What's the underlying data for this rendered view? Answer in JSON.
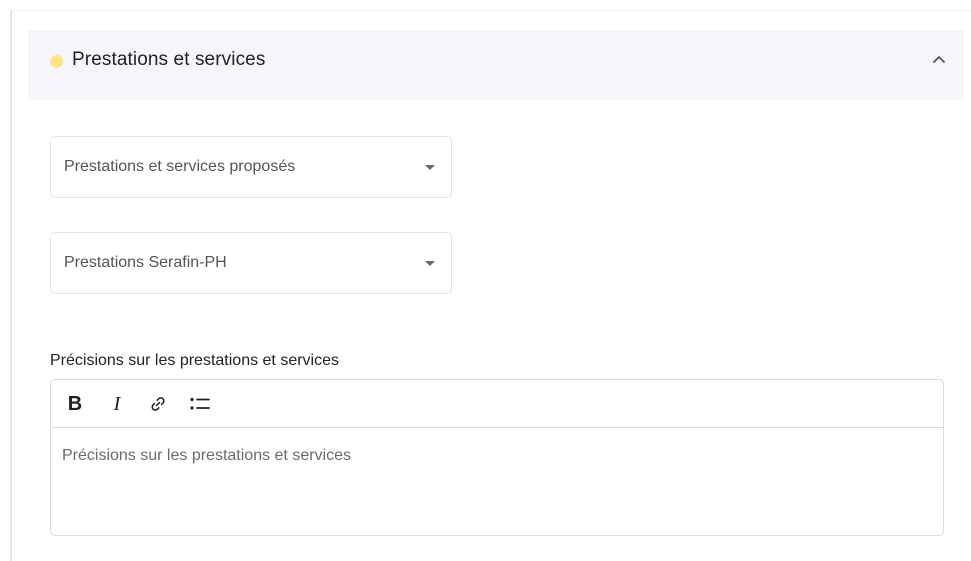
{
  "section": {
    "title": "Prestations et services",
    "status_color": "#fde58a",
    "collapse_icon": "chevron-up-icon"
  },
  "selects": [
    {
      "placeholder": "Prestations et services proposés",
      "icon": "caret-down-icon"
    },
    {
      "placeholder": "Prestations Serafin-PH",
      "icon": "caret-down-icon"
    }
  ],
  "details": {
    "label": "Précisions sur les prestations et services",
    "placeholder": "Précisions sur les prestations et services",
    "toolbar": {
      "bold": "B",
      "italic": "I",
      "link_icon": "link-icon",
      "list_icon": "bullet-list-icon"
    }
  },
  "colors": {
    "header_bg": "#f5f6fb",
    "border": "#e3e3e3",
    "text": "#222222",
    "placeholder": "#6b6b6b"
  }
}
